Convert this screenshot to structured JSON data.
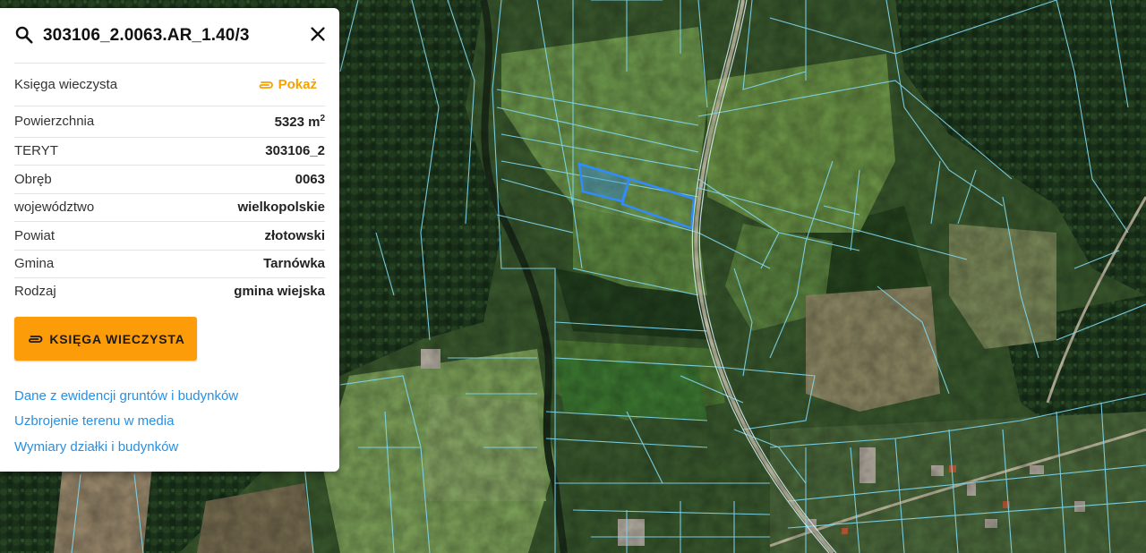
{
  "panel": {
    "title": "303106_2.0063.AR_1.40/3",
    "kw_label": "Księga wieczysta",
    "kw_show": "Pokaż",
    "rows": [
      {
        "label": "Powierzchnia",
        "value": "5323 m",
        "unit_sup": "2"
      },
      {
        "label": "TERYT",
        "value": "303106_2"
      },
      {
        "label": "Obręb",
        "value": "0063"
      },
      {
        "label": "województwo",
        "value": "wielkopolskie"
      },
      {
        "label": "Powiat",
        "value": "złotowski"
      },
      {
        "label": "Gmina",
        "value": "Tarnówka"
      },
      {
        "label": "Rodzaj",
        "value": "gmina wiejska"
      }
    ],
    "button_label": "KSIĘGA WIECZYSTA",
    "links": [
      "Dane z ewidencji gruntów i budynków",
      "Uzbrojenie terenu w media",
      "Wymiary działki i budynków"
    ]
  },
  "colors": {
    "accent": "#fb9c08",
    "link": "#2a8fe0",
    "parcel_line": "#7fd8f0",
    "selected_parcel": "#2f8cff"
  },
  "map": {
    "type": "satellite imagery with cadastral parcel boundaries"
  }
}
